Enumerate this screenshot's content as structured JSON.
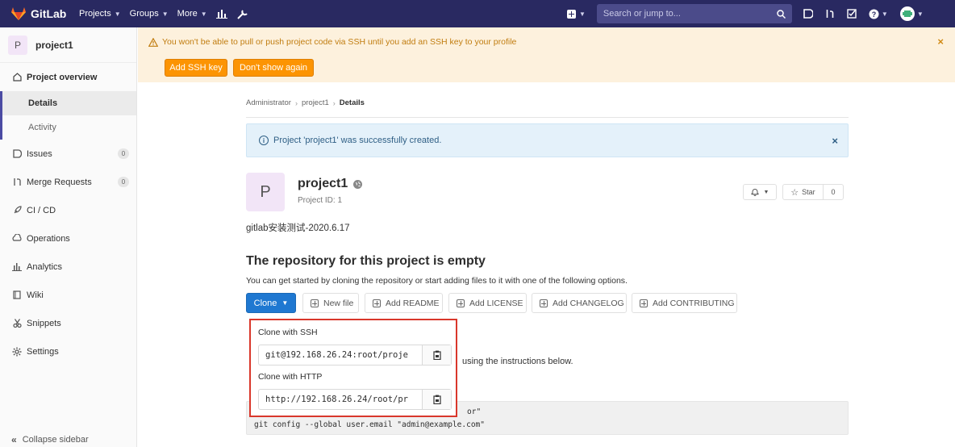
{
  "navbar": {
    "brand": "GitLab",
    "links": [
      "Projects",
      "Groups",
      "More"
    ],
    "search_placeholder": "Search or jump to..."
  },
  "sidebar": {
    "project_initial": "P",
    "project_name": "project1",
    "overview": "Project overview",
    "sub_details": "Details",
    "sub_activity": "Activity",
    "issues": "Issues",
    "issues_count": "0",
    "merge_requests": "Merge Requests",
    "merge_count": "0",
    "cicd": "CI / CD",
    "operations": "Operations",
    "analytics": "Analytics",
    "wiki": "Wiki",
    "snippets": "Snippets",
    "settings": "Settings",
    "collapse": "Collapse sidebar"
  },
  "banner": {
    "text": "You won't be able to pull or push project code via SSH until you add an SSH key to your profile",
    "add_ssh": "Add SSH key",
    "dont_show": "Don't show again",
    "close": "×"
  },
  "breadcrumb": {
    "root": "Administrator",
    "project": "project1",
    "current": "Details"
  },
  "flash": {
    "text": "Project 'project1' was successfully created.",
    "close": "×"
  },
  "project": {
    "initial": "P",
    "name": "project1",
    "id_text": "Project ID: 1",
    "star_label": "Star",
    "star_count": "0",
    "description": "gitlab安装测试-2020.6.17"
  },
  "empty": {
    "heading": "The repository for this project is empty",
    "sub": "You can get started by cloning the repository or start adding files to it with one of the following options."
  },
  "actions": {
    "clone": "Clone",
    "new_file": "New file",
    "add_readme": "Add README",
    "add_license": "Add LICENSE",
    "add_changelog": "Add CHANGELOG",
    "add_contributing": "Add CONTRIBUTING"
  },
  "clone_dropdown": {
    "ssh_label": "Clone with SSH",
    "ssh_value": "git@192.168.26.24:root/proje",
    "http_label": "Clone with HTTP",
    "http_value": "http://192.168.26.24/root/pr"
  },
  "behind": {
    "instructions": "using the instructions below.",
    "code_line1": "or\"",
    "code_line2": "git config --global user.email \"admin@example.com\""
  },
  "colors": {
    "navbar": "#292961",
    "primary": "#1f78d1",
    "warning": "#fc9403",
    "highlight_border": "#d9372b"
  }
}
